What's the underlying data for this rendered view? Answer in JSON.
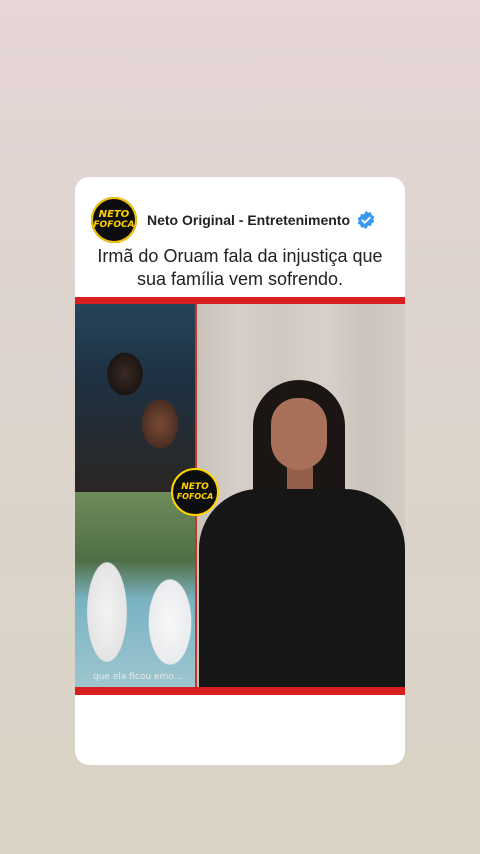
{
  "post": {
    "account_name": "Neto Original - Entretenimento",
    "logo_line1": "NETO",
    "logo_line2": "FOFOCA",
    "title": "Irmã do Oruam fala da injustiça que sua família vem sofrendo.",
    "photo_caption": "que ela ficou emo..."
  },
  "icons": {
    "verified": "verified-badge-icon",
    "logo": "neto-fofoca-logo"
  },
  "colors": {
    "accent_red": "#d81e1e",
    "logo_yellow": "#ffd400",
    "verified_blue": "#3897f0"
  }
}
